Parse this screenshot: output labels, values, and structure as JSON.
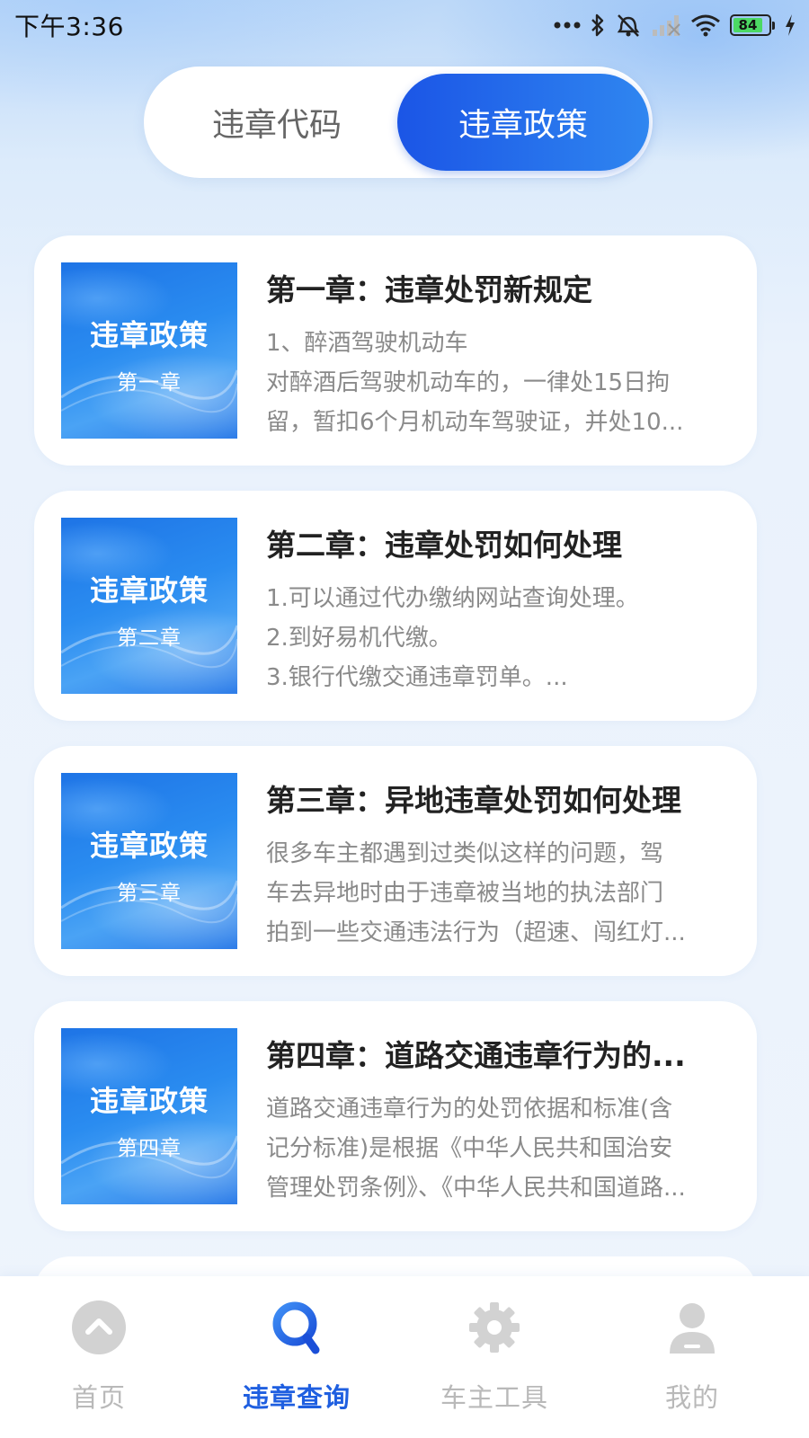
{
  "status_bar": {
    "time": "下午3:36",
    "battery_level": "84",
    "icons": [
      "more-dots-icon",
      "bluetooth-icon",
      "alarm-off-icon",
      "signal-icon",
      "wifi-icon",
      "battery-icon",
      "charging-icon"
    ]
  },
  "tabs": {
    "items": [
      {
        "label": "违章代码",
        "active": false
      },
      {
        "label": "违章政策",
        "active": true
      }
    ]
  },
  "cards": [
    {
      "thumb_title": "违章政策",
      "thumb_sub": "第一章",
      "title": "第一章：违章处罚新规定",
      "lines": [
        "1、醉酒驾驶机动车",
        "对醉酒后驾驶机动车的，一律处15日拘",
        "留，暂扣6个月机动车驾驶证，并处10..."
      ]
    },
    {
      "thumb_title": "违章政策",
      "thumb_sub": "第二章",
      "title": "第二章：违章处罚如何处理",
      "lines": [
        "1.可以通过代办缴纳网站查询处理。",
        "2.到好易机代缴。",
        "3.银行代缴交通违章罚单。..."
      ]
    },
    {
      "thumb_title": "违章政策",
      "thumb_sub": "第三章",
      "title": "第三章：异地违章处罚如何处理",
      "lines": [
        "很多车主都遇到过类似这样的问题，驾",
        "车去异地时由于违章被当地的执法部门",
        "拍到一些交通违法行为（超速、闯红灯..."
      ]
    },
    {
      "thumb_title": "违章政策",
      "thumb_sub": "第四章",
      "title": "第四章：道路交通违章行为的...",
      "lines": [
        "道路交通违章行为的处罚依据和标准(含",
        "记分标准)是根据《中华人民共和国治安",
        "管理处罚条例》、《中华人民共和国道路..."
      ]
    }
  ],
  "bottom_nav": [
    {
      "label": "首页",
      "icon": "home-up-icon",
      "active": false
    },
    {
      "label": "违章查询",
      "icon": "search-icon",
      "active": true
    },
    {
      "label": "车主工具",
      "icon": "gear-icon",
      "active": false
    },
    {
      "label": "我的",
      "icon": "user-icon",
      "active": false
    }
  ],
  "colors": {
    "accent": "#1f5fe0",
    "inactive": "#b9b9b9",
    "card_bg": "#ffffff",
    "page_bg": "#eef4fc"
  }
}
